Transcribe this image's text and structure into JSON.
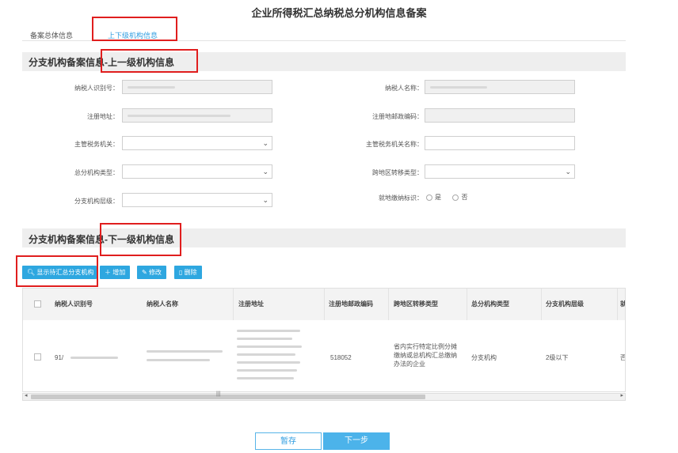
{
  "page": {
    "title": "企业所得税汇总纳税总分机构信息备案"
  },
  "tabs": [
    {
      "label": "备案总体信息",
      "active": false
    },
    {
      "label": "上下级机构信息",
      "active": true
    }
  ],
  "upper_section": {
    "title": "分支机构备案信息-上一级机构信息",
    "fields": {
      "taxpayer_id": {
        "label": "纳税人识别号：",
        "value": ""
      },
      "taxpayer_name": {
        "label": "纳税人名称：",
        "value": ""
      },
      "reg_address": {
        "label": "注册地址：",
        "value": ""
      },
      "reg_postcode": {
        "label": "注册地邮政编码：",
        "value": ""
      },
      "tax_authority": {
        "label": "主管税务机关：",
        "value": ""
      },
      "tax_authority_name": {
        "label": "主管税务机关名称：",
        "value": ""
      },
      "org_type": {
        "label": "总分机构类型：",
        "value": ""
      },
      "cross_region_type": {
        "label": "跨地区转移类型：",
        "value": ""
      },
      "branch_level": {
        "label": "分支机构层级：",
        "value": ""
      },
      "local_pay": {
        "label": "就地缴纳标识：",
        "opt_yes": "是",
        "opt_no": "否"
      }
    }
  },
  "lower_section": {
    "title": "分支机构备案信息-下一级机构信息",
    "toolbar": {
      "show_label": "显示待汇总分支机构",
      "add_label": "增加",
      "edit_label": "修改",
      "delete_label": "删除"
    },
    "table": {
      "columns": [
        "纳税人识别号",
        "纳税人名称",
        "注册地址",
        "注册地邮政编码",
        "跨地区转移类型",
        "总分机构类型",
        "分支机构层级",
        "就"
      ],
      "rows": [
        {
          "taxpayer_id": "91/",
          "taxpayer_name": "",
          "reg_address": "",
          "postcode": "518052",
          "transfer_type": "省内实行特定比例分摊缴纳或总机构汇总缴纳办法的企业",
          "org_type": "分支机构",
          "level": "2级以下",
          "local": "否"
        }
      ]
    }
  },
  "footer": {
    "save_label": "暂存",
    "next_label": "下一步"
  },
  "colors": {
    "accent": "#2ea7e0",
    "highlight_box": "#e01e1e"
  }
}
